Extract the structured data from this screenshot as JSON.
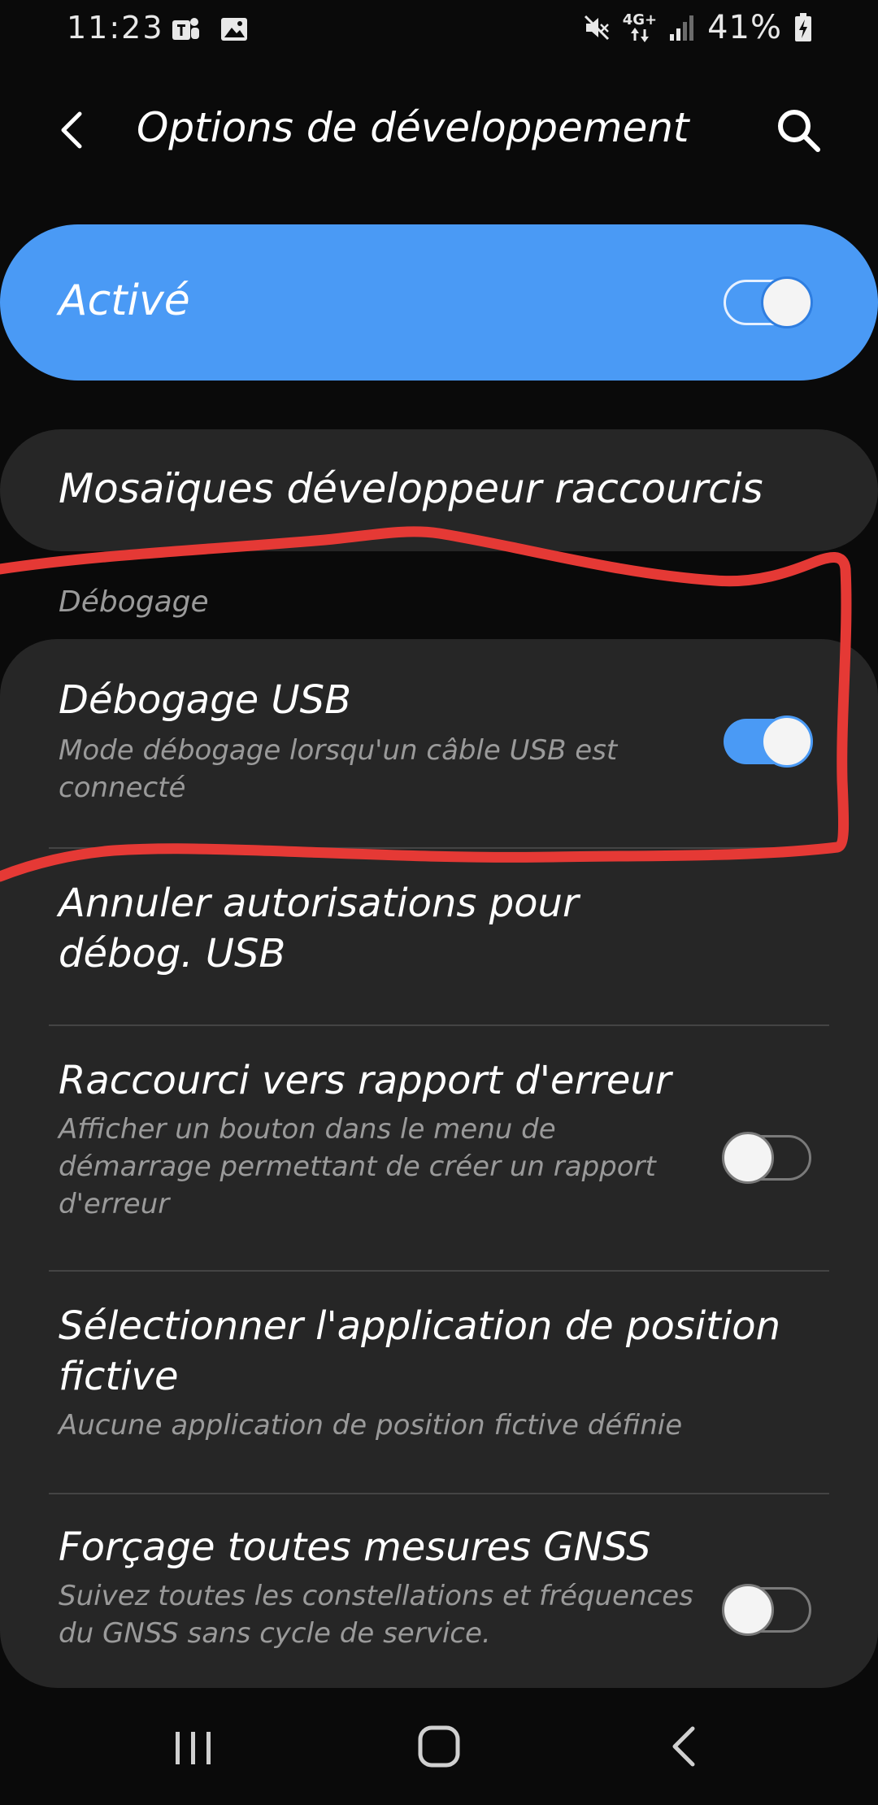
{
  "status_bar": {
    "time": "11:23",
    "left_icons": [
      "teams-icon",
      "gallery-icon"
    ],
    "network": "4G+",
    "battery": "41%",
    "right_icons": [
      "mute-icon",
      "network-arrows-icon",
      "signal-icon",
      "battery-charging-icon"
    ]
  },
  "header": {
    "title": "Options de développement",
    "back_icon": "back-arrow-icon",
    "search_icon": "search-icon"
  },
  "master_switch": {
    "label": "Activé",
    "state": "on"
  },
  "tiles": {
    "label": "Mosaïques développeur raccourcis"
  },
  "section": {
    "header": "Débogage"
  },
  "items": [
    {
      "title": "Débogage USB",
      "subtitle": "Mode débogage lorsqu'un câble USB est connecté",
      "toggle": "on"
    },
    {
      "title": "Annuler autorisations pour débog. USB",
      "subtitle": ""
    },
    {
      "title": "Raccourci vers rapport d'erreur",
      "subtitle": "Afficher un bouton dans le menu de démarrage permettant de créer un rapport d'erreur",
      "toggle": "off"
    },
    {
      "title": "Sélectionner l'application de position fictive",
      "subtitle": "Aucune application de position fictive définie"
    },
    {
      "title": "Forçage toutes mesures GNSS",
      "subtitle": "Suivez toutes les constellations et fréquences du GNSS sans cycle de service.",
      "toggle": "off"
    }
  ],
  "annotation": {
    "color": "#e53935"
  },
  "colors": {
    "accent": "#4a9af5",
    "background": "#0a0a0a",
    "card": "#262626",
    "secondary_text": "#9a9a9a"
  },
  "nav_bar": {
    "icons": [
      "recents-icon",
      "home-icon",
      "back-icon"
    ]
  }
}
